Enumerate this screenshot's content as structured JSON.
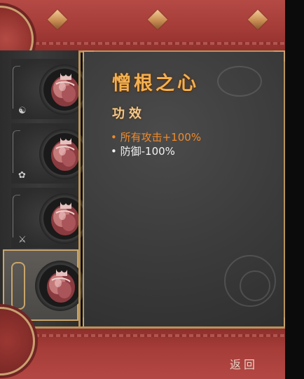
{
  "item": {
    "title": "憎根之心",
    "section_heading": "功效",
    "effects": [
      {
        "text": "• 所有攻击+100%",
        "color": "#f08a2a"
      },
      {
        "text": "• 防御-100%",
        "color": "#f2f2f2"
      }
    ]
  },
  "inventory": {
    "slots": [
      {
        "icon": "heart-item-icon",
        "symbol": "☯"
      },
      {
        "icon": "heart-item-icon",
        "symbol": "✿"
      },
      {
        "icon": "heart-item-icon",
        "symbol": "⚔"
      },
      {
        "icon": "heart-item-icon",
        "symbol": "",
        "selected": true
      }
    ]
  },
  "footer": {
    "return_label": "返回"
  },
  "colors": {
    "accent_gold": "#b8945a",
    "bar_red": "#a53c38",
    "title_orange": "#f2b04f",
    "buff_orange": "#f08a2a"
  }
}
